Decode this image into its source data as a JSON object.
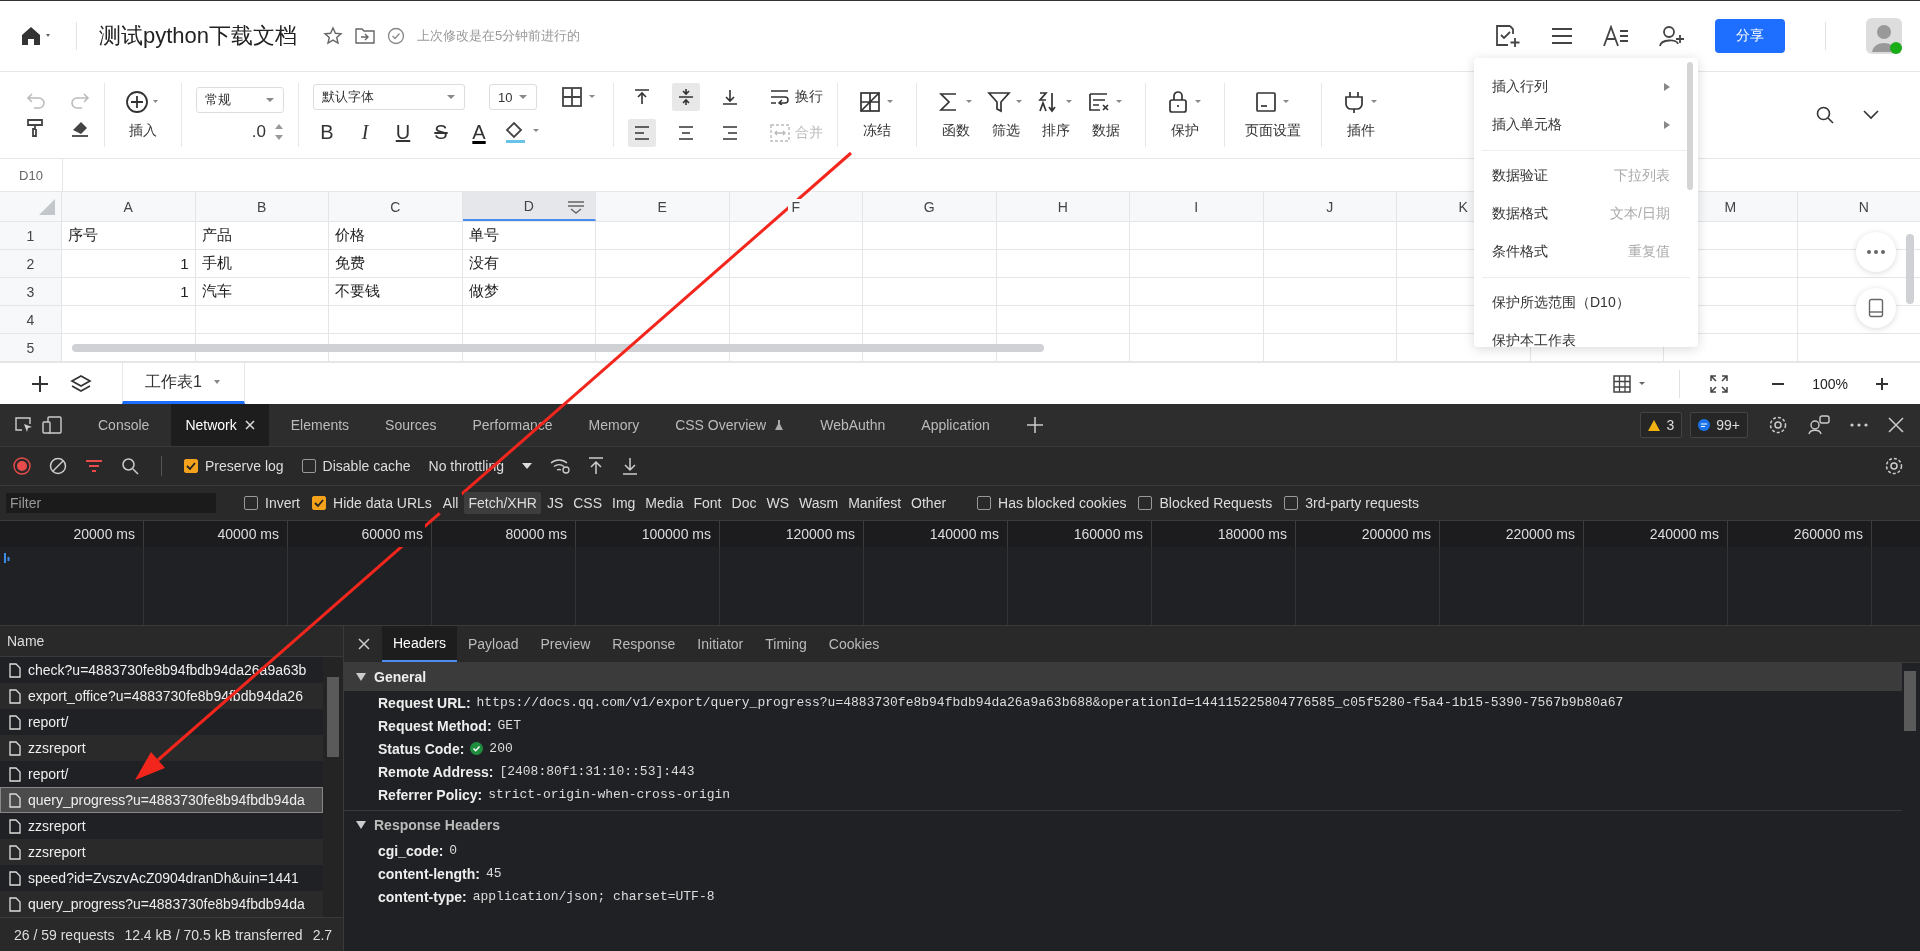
{
  "doc_header": {
    "title": "测试python下载文档",
    "save_status": "上次修改是在5分钟前进行的",
    "share_button": "分享"
  },
  "toolbar": {
    "insert": "插入",
    "style_select": "常规",
    "decimal": ".0",
    "font_select": "默认字体",
    "size_select": "10",
    "format_buttons": [
      {
        "kind": "bold",
        "label": "B"
      },
      {
        "kind": "italic",
        "label": "I"
      },
      {
        "kind": "underline",
        "label": "U"
      },
      {
        "kind": "strike",
        "label": "S"
      },
      {
        "kind": "color",
        "label": "A"
      }
    ],
    "align_buttons": [
      {
        "kind": "top",
        "selected": false
      },
      {
        "kind": "middle",
        "selected": true
      },
      {
        "kind": "bottom",
        "selected": false
      },
      {
        "kind": "left",
        "selected": true
      },
      {
        "kind": "center",
        "selected": false
      },
      {
        "kind": "right",
        "selected": false
      }
    ],
    "wrap": {
      "label": "换行",
      "disabled": false
    },
    "merge": {
      "label": "合并",
      "disabled": true
    },
    "tools": [
      {
        "kind": "freeze",
        "label": "冻结"
      },
      {
        "kind": "function",
        "label": "函数"
      },
      {
        "kind": "filter",
        "label": "筛选"
      },
      {
        "kind": "sort",
        "label": "排序"
      },
      {
        "kind": "data",
        "label": "数据"
      },
      {
        "kind": "protect",
        "label": "保护"
      },
      {
        "kind": "page",
        "label": "页面设置"
      },
      {
        "kind": "plugin",
        "label": "插件"
      }
    ]
  },
  "name_box": "D10",
  "sheet": {
    "columns": [
      {
        "label": "A",
        "selected": false
      },
      {
        "label": "B",
        "selected": false
      },
      {
        "label": "C",
        "selected": false
      },
      {
        "label": "D",
        "selected": true
      },
      {
        "label": "E",
        "selected": false
      },
      {
        "label": "F",
        "selected": false
      },
      {
        "label": "G",
        "selected": false
      },
      {
        "label": "H",
        "selected": false
      },
      {
        "label": "I",
        "selected": false
      },
      {
        "label": "J",
        "selected": false
      },
      {
        "label": "K",
        "selected": false
      },
      {},
      {
        "label": "M",
        "selected": false
      },
      {
        "label": "N",
        "selected": false
      }
    ],
    "rows": [
      {
        "number": "1",
        "cells": [
          {
            "text": "序号",
            "kind": "text"
          },
          {
            "text": "产品",
            "kind": "text"
          },
          {
            "text": "价格",
            "kind": "text"
          },
          {
            "text": "单号",
            "kind": "text"
          }
        ]
      },
      {
        "number": "2",
        "cells": [
          {
            "text": "1",
            "kind": "number"
          },
          {
            "text": "手机",
            "kind": "text"
          },
          {
            "text": "免费",
            "kind": "text"
          },
          {
            "text": "没有",
            "kind": "text"
          }
        ]
      },
      {
        "number": "3",
        "cells": [
          {
            "text": "1",
            "kind": "number"
          },
          {
            "text": "汽车",
            "kind": "text"
          },
          {
            "text": "不要钱",
            "kind": "text"
          },
          {
            "text": "做梦",
            "kind": "text"
          }
        ]
      },
      {
        "number": "4",
        "cells": []
      },
      {
        "number": "5",
        "cells": []
      }
    ]
  },
  "sheet_tabs": [
    {
      "label": "工作表1",
      "selected": true
    }
  ],
  "zoom": "100%",
  "context_menu": {
    "groups": [
      [
        {
          "label": "插入行列",
          "submenu": true
        },
        {
          "label": "插入单元格",
          "submenu": true
        }
      ],
      [
        {
          "label": "数据验证",
          "shortcut": "下拉列表",
          "submenu": false
        },
        {
          "label": "数据格式",
          "shortcut": "文本/日期",
          "submenu": false
        },
        {
          "label": "条件格式",
          "shortcut": "重复值",
          "submenu": false
        }
      ],
      [
        {
          "label": "保护所选范围（D10）",
          "submenu": false
        },
        {
          "label": "保护本工作表",
          "submenu": false
        }
      ]
    ]
  },
  "devtools": {
    "tabs": [
      {
        "label": "Console",
        "selected": false,
        "kind": "plain"
      },
      {
        "label": "Network",
        "selected": true,
        "kind": "closable"
      },
      {
        "label": "Elements",
        "selected": false,
        "kind": "plain"
      },
      {
        "label": "Sources",
        "selected": false,
        "kind": "plain"
      },
      {
        "label": "Performance",
        "selected": false,
        "kind": "plain"
      },
      {
        "label": "Memory",
        "selected": false,
        "kind": "plain"
      },
      {
        "label": "CSS Overview",
        "selected": false,
        "kind": "experimental"
      },
      {
        "label": "WebAuthn",
        "selected": false,
        "kind": "plain"
      },
      {
        "label": "Application",
        "selected": false,
        "kind": "plain"
      }
    ],
    "warnings": "3",
    "messages": "99+",
    "preserve_log": {
      "label": "Preserve log",
      "checked": true
    },
    "disable_cache": {
      "label": "Disable cache",
      "checked": false
    },
    "throttling": "No throttling",
    "filter": {
      "placeholder": "Filter"
    },
    "filter_options": [
      {
        "label": "Invert",
        "checked": false
      },
      {
        "label": "Hide data URLs",
        "checked": true
      }
    ],
    "type_filters": [
      {
        "label": "All",
        "selected": false
      },
      {
        "label": "Fetch/XHR",
        "selected": true
      },
      {
        "label": "JS",
        "selected": false
      },
      {
        "label": "CSS",
        "selected": false
      },
      {
        "label": "Img",
        "selected": false
      },
      {
        "label": "Media",
        "selected": false
      },
      {
        "label": "Font",
        "selected": false
      },
      {
        "label": "Doc",
        "selected": false
      },
      {
        "label": "WS",
        "selected": false
      },
      {
        "label": "Wasm",
        "selected": false
      },
      {
        "label": "Manifest",
        "selected": false
      },
      {
        "label": "Other",
        "selected": false
      }
    ],
    "extra_filters": [
      {
        "label": "Has blocked cookies",
        "checked": false
      },
      {
        "label": "Blocked Requests",
        "checked": false
      },
      {
        "label": "3rd-party requests",
        "checked": false
      }
    ],
    "timeline_ticks": [
      "20000 ms",
      "40000 ms",
      "60000 ms",
      "80000 ms",
      "100000 ms",
      "120000 ms",
      "140000 ms",
      "160000 ms",
      "180000 ms",
      "200000 ms",
      "220000 ms",
      "240000 ms",
      "260000 ms"
    ],
    "requests": {
      "header": "Name",
      "rows": [
        {
          "name": "check?u=4883730fe8b94fbdb94da26a9a63b",
          "selected": false
        },
        {
          "name": "export_office?u=4883730fe8b94fbdb94da26",
          "selected": false
        },
        {
          "name": "report/",
          "selected": false
        },
        {
          "name": "zzsreport",
          "selected": false
        },
        {
          "name": "report/",
          "selected": false
        },
        {
          "name": "query_progress?u=4883730fe8b94fbdb94da",
          "selected": true
        },
        {
          "name": "zzsreport",
          "selected": false
        },
        {
          "name": "zzsreport",
          "selected": false
        },
        {
          "name": "speed?id=ZvszvAcZ0904dranDh&uin=1441",
          "selected": false
        },
        {
          "name": "query_progress?u=4883730fe8b94fbdb94da",
          "selected": false
        }
      ]
    },
    "detail_tabs": [
      {
        "label": "Headers",
        "selected": true
      },
      {
        "label": "Payload",
        "selected": false
      },
      {
        "label": "Preview",
        "selected": false
      },
      {
        "label": "Response",
        "selected": false
      },
      {
        "label": "Initiator",
        "selected": false
      },
      {
        "label": "Timing",
        "selected": false
      },
      {
        "label": "Cookies",
        "selected": false
      }
    ],
    "sections": [
      {
        "title": "General",
        "expanded": true,
        "rows": [
          {
            "key": "Request URL:",
            "value": "https://docs.qq.com/v1/export/query_progress?u=4883730fe8b94fbdb94da26a9a63b688&operationId=144115225804776585_c05f5280-f5a4-1b15-5390-7567b9b80a67",
            "kind": "plain"
          },
          {
            "key": "Request Method:",
            "value": "GET",
            "kind": "plain"
          },
          {
            "key": "Status Code:",
            "value": "200",
            "kind": "status"
          },
          {
            "key": "Remote Address:",
            "value": "[2408:80f1:31:10::53]:443",
            "kind": "plain"
          },
          {
            "key": "Referrer Policy:",
            "value": "strict-origin-when-cross-origin",
            "kind": "plain"
          }
        ]
      },
      {
        "title": "Response Headers",
        "expanded": true,
        "rows": [
          {
            "key": "cgi_code:",
            "value": "0",
            "kind": "plain"
          },
          {
            "key": "content-length:",
            "value": "45",
            "kind": "plain"
          },
          {
            "key": "content-type:",
            "value": "application/json; charset=UTF-8",
            "kind": "plain"
          }
        ]
      }
    ],
    "status_bar": [
      "26 / 59 requests",
      "12.4 kB / 70.5 kB transferred",
      "2.7"
    ]
  }
}
